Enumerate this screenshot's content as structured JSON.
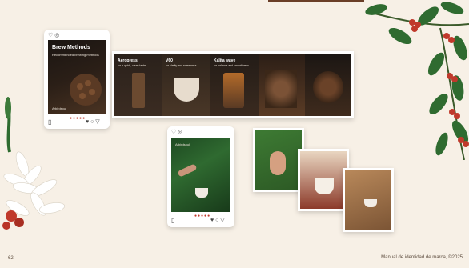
{
  "page": {
    "number": "62",
    "footer": "Manual de identidad de marca, ©2025"
  },
  "carousel": {
    "slides": [
      {
        "title": "Brew Methods",
        "subtitle": "Recommended brewing methods"
      },
      {
        "title": "Aeropress",
        "subtitle": "for a quick, clean taste"
      },
      {
        "title": "V60",
        "subtitle": "for clarity and sweetness"
      },
      {
        "title": "Kalita wave",
        "subtitle": "for balance and smoothness"
      },
      {
        "title": "",
        "subtitle": ""
      }
    ],
    "brand": "Arbirdsoul"
  },
  "post": {
    "brand": "Arbirdsoul"
  },
  "colors": {
    "bg": "#f7f0e6",
    "dark": "#1f1a16",
    "accent_red": "#c0392b",
    "leaf": "#2e6b2f"
  }
}
